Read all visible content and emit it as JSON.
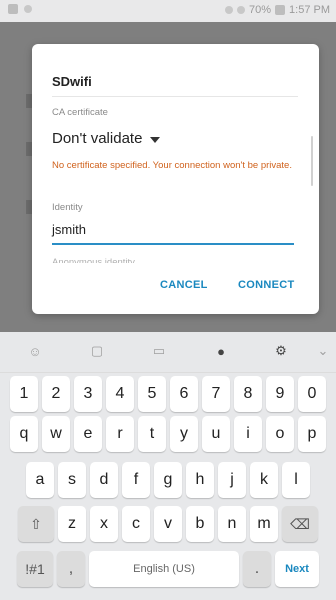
{
  "status_bar": {
    "time": "1:57 PM",
    "battery": "70%"
  },
  "dialog": {
    "title": "SDwifi",
    "ca_label": "CA certificate",
    "ca_value": "Don't validate",
    "warning": "No certificate specified. Your connection won't be private.",
    "identity_label": "Identity",
    "identity_value": "jsmith",
    "anon_label": "Anonymous identity",
    "cancel": "CANCEL",
    "connect": "CONNECT"
  },
  "keyboard": {
    "row1": [
      "1",
      "2",
      "3",
      "4",
      "5",
      "6",
      "7",
      "8",
      "9",
      "0"
    ],
    "row2": [
      "q",
      "w",
      "e",
      "r",
      "t",
      "y",
      "u",
      "i",
      "o",
      "p"
    ],
    "row3": [
      "a",
      "s",
      "d",
      "f",
      "g",
      "h",
      "j",
      "k",
      "l"
    ],
    "row4": [
      "z",
      "x",
      "c",
      "v",
      "b",
      "n",
      "m"
    ],
    "symbols": "!#1",
    "comma": ",",
    "space": "English (US)",
    "period": ".",
    "next": "Next"
  },
  "colors": {
    "accent": "#1a88bf",
    "warning": "#d0621d",
    "input_underline": "#2a8ec6"
  }
}
